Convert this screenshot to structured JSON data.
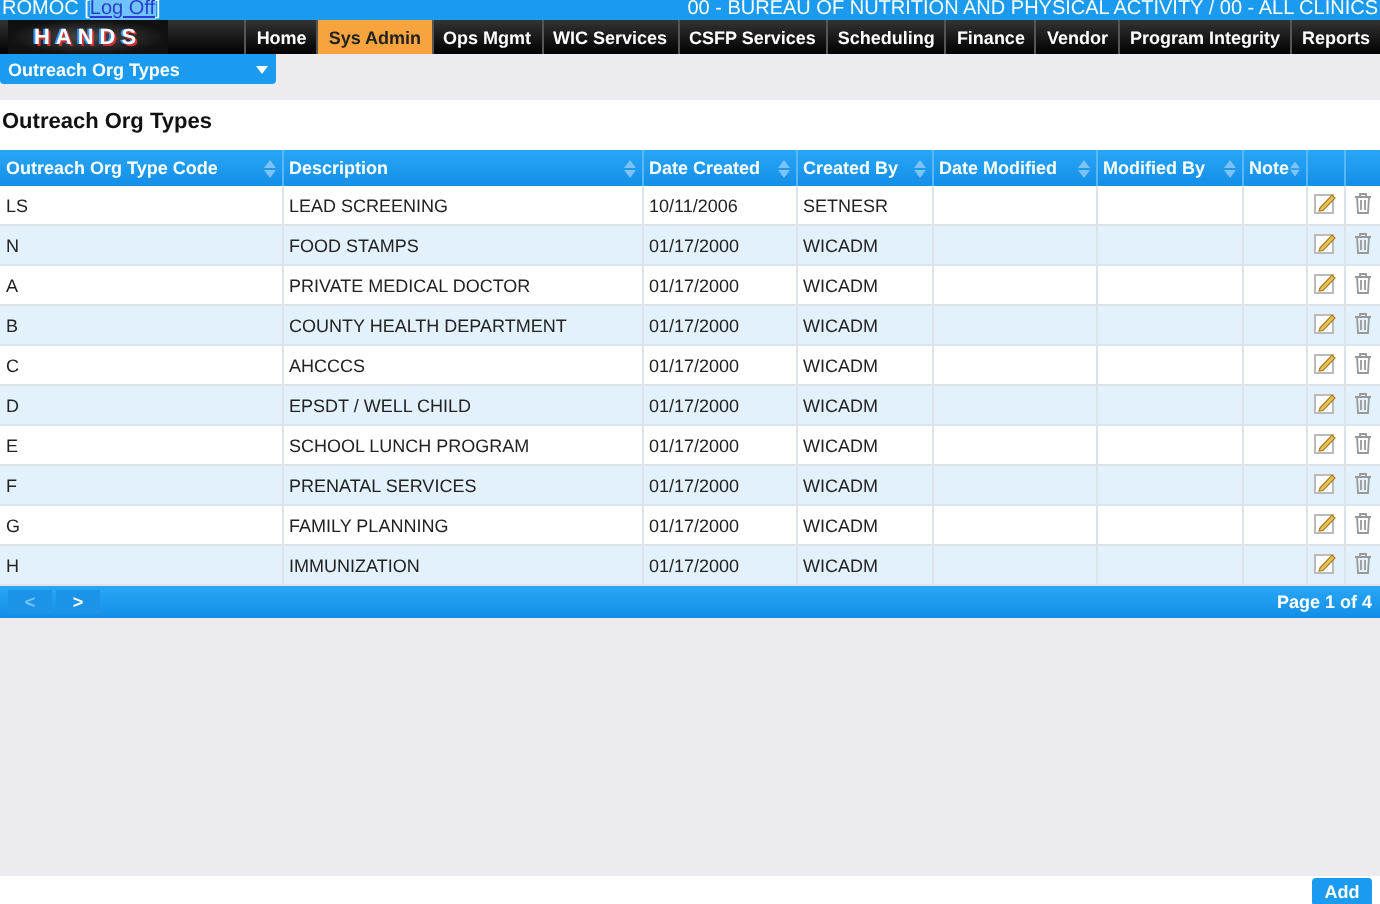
{
  "top_bar": {
    "user": "ROMOC",
    "bracket_open": "[",
    "log_off": "Log Off",
    "bracket_close": "]",
    "context": "00 - BUREAU OF NUTRITION AND PHYSICAL ACTIVITY / 00 - ALL CLINICS"
  },
  "logo": {
    "text": "HANDS"
  },
  "nav": [
    {
      "label": "Home",
      "selected": false
    },
    {
      "label": "Sys Admin",
      "selected": true
    },
    {
      "label": "Ops Mgmt",
      "selected": false
    },
    {
      "label": "WIC Services",
      "selected": false
    },
    {
      "label": "CSFP Services",
      "selected": false
    },
    {
      "label": "Scheduling",
      "selected": false
    },
    {
      "label": "Finance",
      "selected": false
    },
    {
      "label": "Vendor",
      "selected": false
    },
    {
      "label": "Program Integrity",
      "selected": false
    },
    {
      "label": "Reports",
      "selected": false
    }
  ],
  "page_selector": {
    "value": "Outreach Org Types"
  },
  "title": "Outreach Org Types",
  "table": {
    "columns": [
      "Outreach Org Type Code",
      "Description",
      "Date Created",
      "Created By",
      "Date Modified",
      "Modified By",
      "Note"
    ],
    "rows": [
      [
        "LS",
        "LEAD SCREENING",
        "10/11/2006",
        "SETNESR",
        "",
        "",
        ""
      ],
      [
        "N",
        "FOOD STAMPS",
        "01/17/2000",
        "WICADM",
        "",
        "",
        ""
      ],
      [
        "A",
        "PRIVATE MEDICAL DOCTOR",
        "01/17/2000",
        "WICADM",
        "",
        "",
        ""
      ],
      [
        "B",
        "COUNTY HEALTH DEPARTMENT",
        "01/17/2000",
        "WICADM",
        "",
        "",
        ""
      ],
      [
        "C",
        "AHCCCS",
        "01/17/2000",
        "WICADM",
        "",
        "",
        ""
      ],
      [
        "D",
        "EPSDT / WELL CHILD",
        "01/17/2000",
        "WICADM",
        "",
        "",
        ""
      ],
      [
        "E",
        "SCHOOL LUNCH PROGRAM",
        "01/17/2000",
        "WICADM",
        "",
        "",
        ""
      ],
      [
        "F",
        "PRENATAL SERVICES",
        "01/17/2000",
        "WICADM",
        "",
        "",
        ""
      ],
      [
        "G",
        "FAMILY PLANNING",
        "01/17/2000",
        "WICADM",
        "",
        "",
        ""
      ],
      [
        "H",
        "IMMUNIZATION",
        "01/17/2000",
        "WICADM",
        "",
        "",
        ""
      ]
    ]
  },
  "pager": {
    "prev": {
      "label": "<",
      "disabled": true
    },
    "next": {
      "label": ">",
      "disabled": false
    },
    "status": "Page 1 of 4"
  },
  "add_button": "Add"
}
